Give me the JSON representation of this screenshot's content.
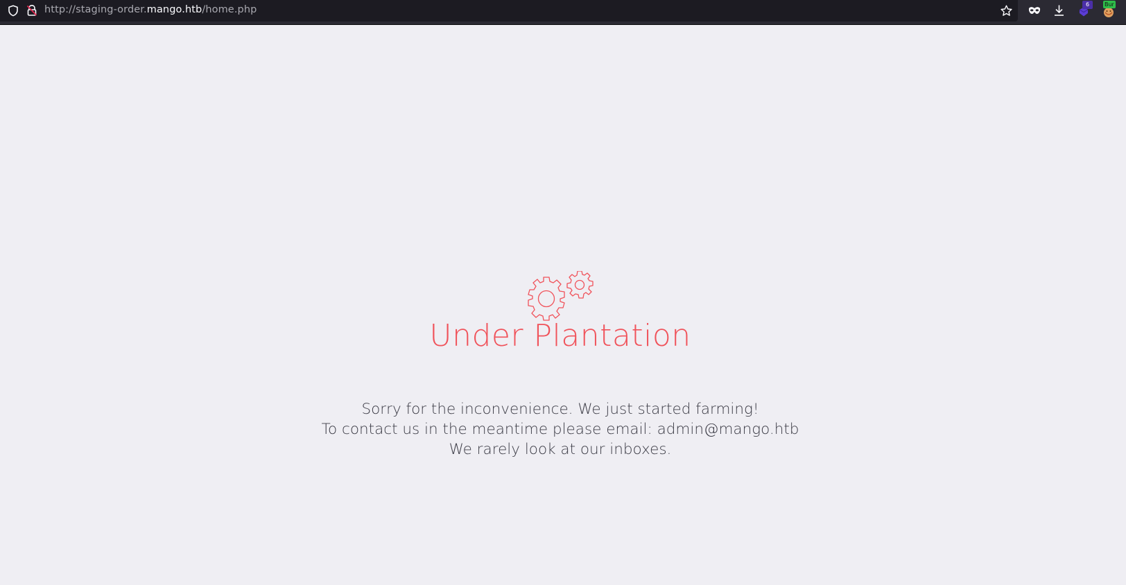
{
  "browser": {
    "url_prefix": "http://staging-order.",
    "url_host": "mango.htb",
    "url_path": "/home.php",
    "extension_badge_count": "6",
    "burp_label": "Bur"
  },
  "icons": {
    "shield": "shield-icon",
    "lock": "insecure-lock-icon",
    "star": "bookmark-star-icon",
    "mask": "private-mask-icon",
    "download": "download-icon",
    "extension": "extension-icon",
    "burp": "burp-extension-icon",
    "gears": "gears-icon"
  },
  "page": {
    "title": "Under Plantation",
    "lines": [
      "Sorry for the inconvenience. We just started farming!",
      "To contact us in the meantime please email: admin@mango.htb",
      "We rarely look at our inboxes."
    ]
  },
  "colors": {
    "accent": "#f0525a",
    "background": "#efeef3",
    "toolbar": "#2b2a33",
    "urlbar": "#1c1b22"
  }
}
